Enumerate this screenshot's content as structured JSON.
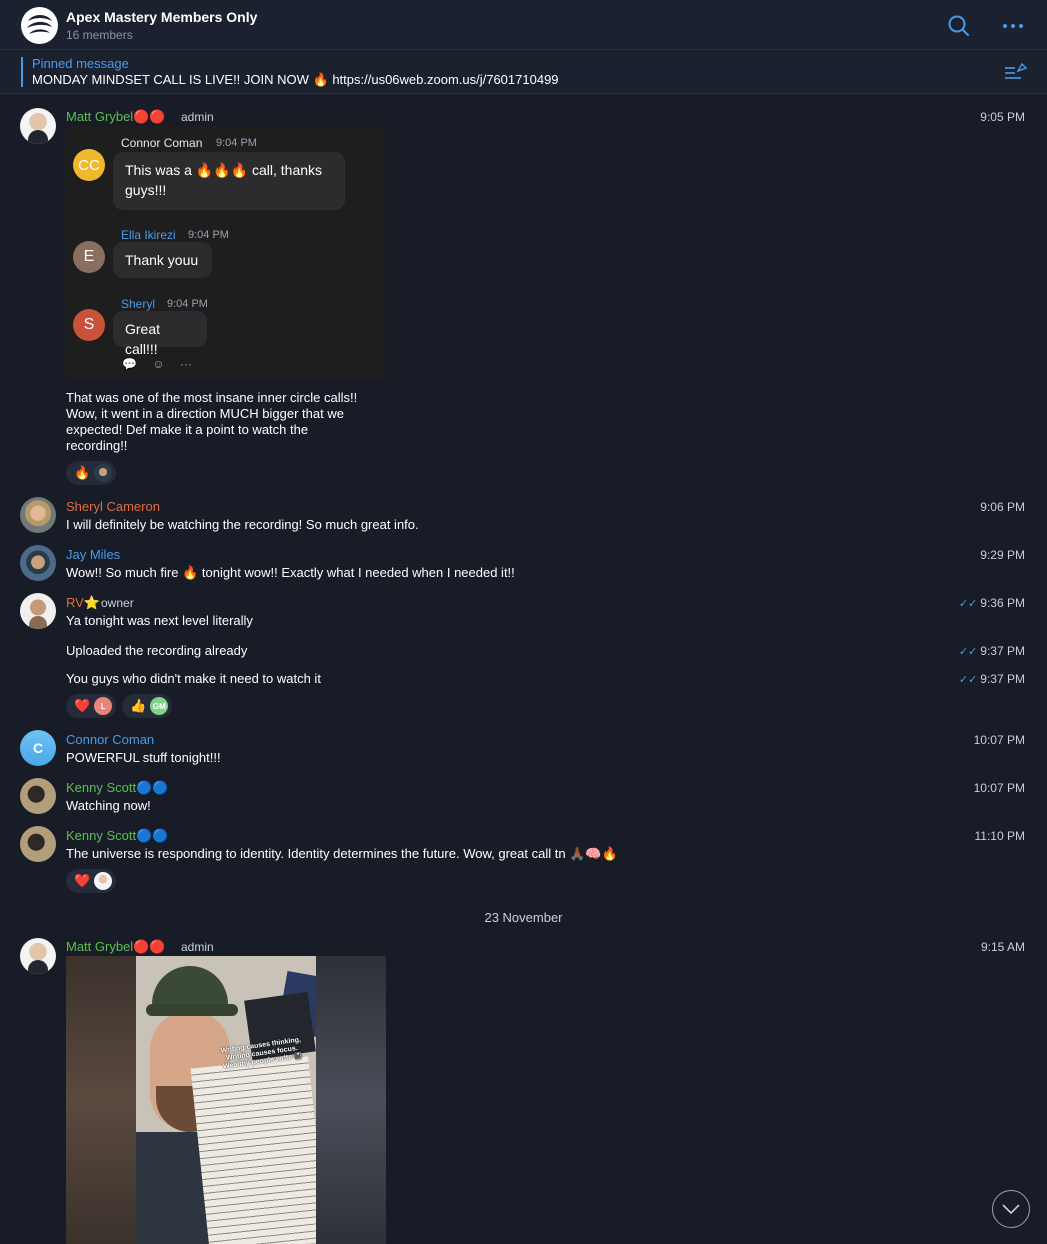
{
  "header": {
    "title": "Apex Mastery Members Only",
    "members": "16 members",
    "logo": "spiral-logo",
    "search_icon": "search-icon",
    "more_icon": "more-icon"
  },
  "pinned": {
    "label": "Pinned message",
    "text": "MONDAY MINDSET CALL IS LIVE!!  JOIN NOW 🔥  https://us06web.zoom.us/j/7601710499",
    "icon": "pinned-list-icon"
  },
  "messages": {
    "m1": {
      "author": "Matt Grybel🔴🔴",
      "role": "admin",
      "time": "9:05 PM",
      "forwarded": {
        "c1_initials": "CC",
        "c1_name": "Connor Coman",
        "c1_time": "9:04 PM",
        "c1_text": "This was a 🔥🔥🔥 call, thanks guys!!!",
        "c2_initial": "E",
        "c2_name": "Ella Ikirezi",
        "c2_time": "9:04 PM",
        "c2_text": "Thank youu",
        "c3_initial": "S",
        "c3_name": "Sheryl",
        "c3_time": "9:04 PM",
        "c3_text": "Great call!!!",
        "action_reply": "💬",
        "action_react": "☺",
        "action_more": "···"
      },
      "text_l1": "That was one of the most insane inner circle calls!!",
      "text_l2": "Wow, it went in a direction MUCH bigger that we",
      "text_l3": "expected! Def make it a point to watch the",
      "text_l4": "recording!!",
      "reaction1": "🔥"
    },
    "m2": {
      "author": "Sheryl Cameron",
      "time": "9:06 PM",
      "text": "I will definitely be watching the recording! So much great info."
    },
    "m3": {
      "author": "Jay Miles",
      "time": "9:29 PM",
      "text": "Wow!! So much fire 🔥 tonight wow!! Exactly what I needed when I needed it!!"
    },
    "m4": {
      "author": "RV",
      "star": "⭐",
      "role": "owner",
      "time": "9:36 PM",
      "text": "Ya tonight was next level literally",
      "check": "✓✓"
    },
    "m5": {
      "time": "9:37 PM",
      "text": "Uploaded the recording already"
    },
    "m6": {
      "time": "9:37 PM",
      "text": "You guys who didn't make it need to watch it",
      "reaction1": "❤️",
      "reaction1_av": "L",
      "reaction2": "👍",
      "reaction2_av": "GM"
    },
    "m7": {
      "author": "Connor Coman",
      "initial": "C",
      "time": "10:07 PM",
      "text": "POWERFUL stuff tonight!!!"
    },
    "m8": {
      "author": "Kenny Scott🔵🔵",
      "time": "10:07 PM",
      "text": "Watching now!"
    },
    "m9": {
      "author": "Kenny Scott🔵🔵",
      "time": "11:10 PM",
      "text": "The universe is responding to identity. Identity determines the future. Wow, great call tn 🙏🏾🧠🔥",
      "reaction1": "❤️"
    },
    "date_separator": "23 November",
    "m10": {
      "author": "Matt Grybel🔴🔴",
      "role": "admin",
      "time": "9:15 AM",
      "media_caption_l1": "Writing causes thinking,",
      "media_caption_l2": "Writing causes focus.",
      "media_caption_l3": "Wealthy people write 📓"
    }
  },
  "scroll_icon": "chevron-down-icon",
  "colors": {
    "background": "#181c27",
    "accent": "#4a9bea",
    "admin_name": "#5fbf52",
    "orange_name": "#e06c45"
  }
}
